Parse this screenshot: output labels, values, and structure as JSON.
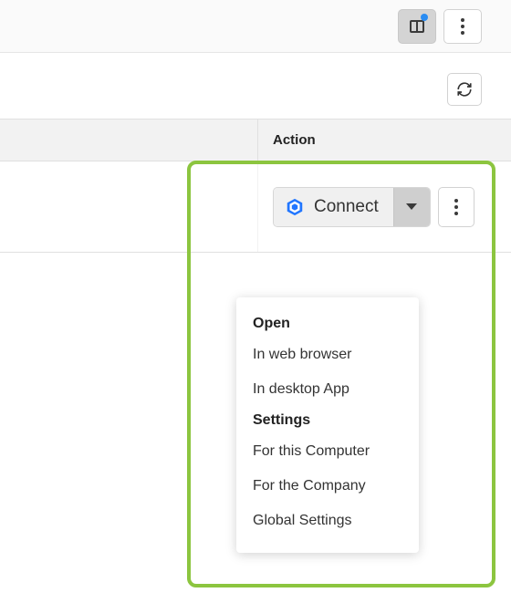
{
  "table": {
    "header_action": "Action",
    "connect_label": "Connect"
  },
  "menu": {
    "section_open": "Open",
    "open_items": [
      "In web browser",
      "In desktop App"
    ],
    "section_settings": "Settings",
    "settings_items": [
      "For this Computer",
      "For the Company",
      "Global Settings"
    ]
  }
}
